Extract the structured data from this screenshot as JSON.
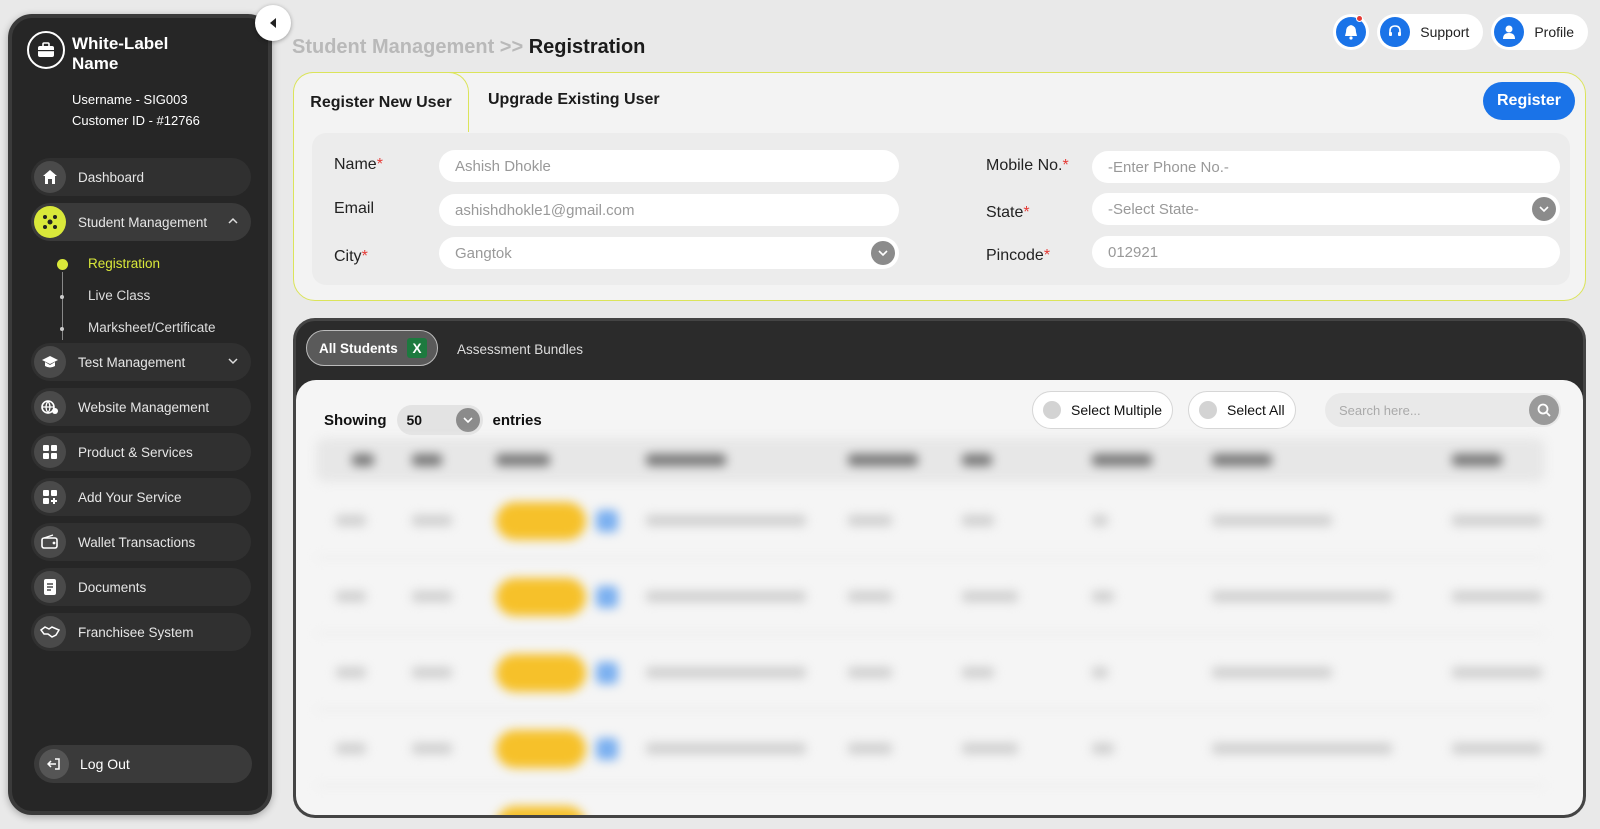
{
  "sidebar": {
    "brand_name": "White-Label Name",
    "username": "Username - SIG003",
    "customer_id": "Customer ID - #12766",
    "nav": [
      {
        "label": "Dashboard",
        "icon": "home-icon"
      },
      {
        "label": "Student Management",
        "icon": "people-network-icon"
      },
      {
        "label": "Test Management",
        "icon": "graduation-cap-icon"
      },
      {
        "label": "Website Management",
        "icon": "globe-gear-icon"
      },
      {
        "label": "Product & Services",
        "icon": "grid-icon"
      },
      {
        "label": "Add Your Service",
        "icon": "grid-add-icon"
      },
      {
        "label": "Wallet Transactions",
        "icon": "wallet-icon"
      },
      {
        "label": "Documents",
        "icon": "document-icon"
      },
      {
        "label": "Franchisee System",
        "icon": "handshake-icon"
      }
    ],
    "sub_items": [
      "Registration",
      "Live Class",
      "Marksheet/Certificate"
    ],
    "logout": "Log Out"
  },
  "header": {
    "breadcrumb_parent": "Student Management >>",
    "breadcrumb_current": "Registration",
    "support": "Support",
    "profile": "Profile"
  },
  "form": {
    "tab_active": "Register New User",
    "tab_inactive": "Upgrade Existing User",
    "register_button": "Register",
    "name_label": "Name",
    "name_value": "Ashish Dhokle",
    "email_label": "Email",
    "email_value": "ashishdhokle1@gmail.com",
    "city_label": "City",
    "city_value": "Gangtok",
    "mobile_label": "Mobile No.",
    "mobile_placeholder": "-Enter Phone No.-",
    "state_label": "State",
    "state_placeholder": "-Select State-",
    "pincode_label": "Pincode",
    "pincode_value": "012921",
    "required_mark": "*"
  },
  "table": {
    "tab_active": "All Students",
    "tab_inactive": "Assessment Bundles",
    "showing_label": "Showing",
    "entries_value": "50",
    "entries_label": "entries",
    "select_multiple": "Select Multiple",
    "select_all": "Select All",
    "search_placeholder": "Search here..."
  },
  "colors": {
    "accent_blue": "#1a73e8",
    "accent_lime": "#d9e83a",
    "sidebar_bg": "#262626"
  }
}
